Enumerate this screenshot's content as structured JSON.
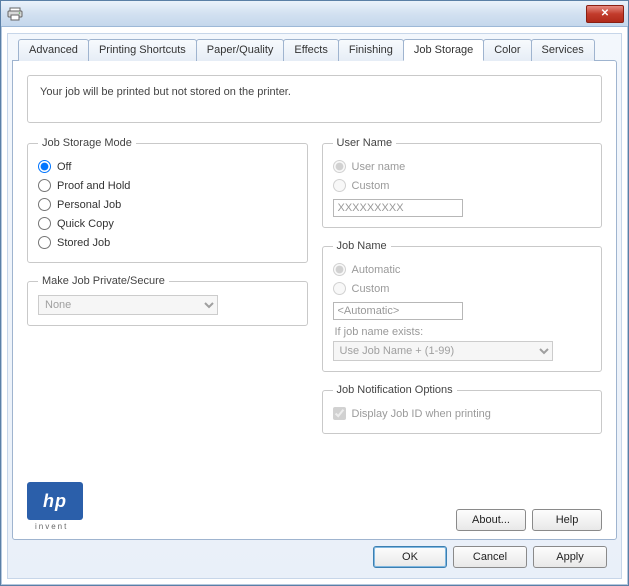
{
  "titlebar": {
    "close_symbol": "✕"
  },
  "tabs": [
    {
      "label": "Advanced"
    },
    {
      "label": "Printing Shortcuts"
    },
    {
      "label": "Paper/Quality"
    },
    {
      "label": "Effects"
    },
    {
      "label": "Finishing"
    },
    {
      "label": "Job Storage"
    },
    {
      "label": "Color"
    },
    {
      "label": "Services"
    }
  ],
  "active_tab_index": 5,
  "info_text": "Your job will be printed but not stored on the printer.",
  "job_storage_mode": {
    "legend": "Job Storage Mode",
    "options": [
      "Off",
      "Proof and Hold",
      "Personal Job",
      "Quick Copy",
      "Stored Job"
    ],
    "selected_index": 0
  },
  "make_private": {
    "legend": "Make Job Private/Secure",
    "select_value": "None"
  },
  "user_name": {
    "legend": "User Name",
    "options": [
      "User name",
      "Custom"
    ],
    "selected_index": 0,
    "custom_value": "XXXXXXXXX"
  },
  "job_name": {
    "legend": "Job Name",
    "options": [
      "Automatic",
      "Custom"
    ],
    "selected_index": 0,
    "custom_value": "<Automatic>",
    "exists_label": "If job name exists:",
    "exists_value": "Use Job Name + (1-99)"
  },
  "job_notification": {
    "legend": "Job Notification Options",
    "checkbox_label": "Display Job ID when printing",
    "checked": true
  },
  "logo": {
    "text": "hp",
    "sub": "invent"
  },
  "buttons": {
    "about": "About...",
    "help": "Help",
    "ok": "OK",
    "cancel": "Cancel",
    "apply": "Apply"
  }
}
